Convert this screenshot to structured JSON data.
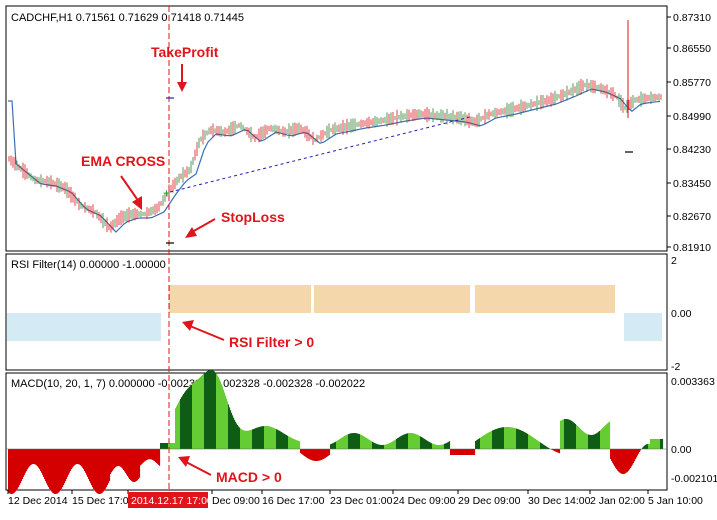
{
  "main_panel": {
    "header": "CADCHF,H1  0.71561 0.71629 0.71418 0.71445",
    "price_ticks": [
      "0.87310",
      "0.86550",
      "0.85770",
      "0.84990",
      "0.84230",
      "0.83450",
      "0.82670",
      "0.81910"
    ]
  },
  "rsi_panel": {
    "header": "RSI Filter(14) 0.00000 -1.00000",
    "ticks": [
      "2",
      "0.00",
      "-2"
    ]
  },
  "macd_panel": {
    "header": "MACD(10, 20, 1, 7) 0.000000 -0.002328 -0.002328 -0.002328 -0.002022",
    "ticks": [
      "0.003363",
      "0.00",
      "-0.002101"
    ]
  },
  "time_axis": {
    "labels": [
      "12 Dec 2014",
      "15 Dec 17:00",
      "2014.12.17 17:00",
      "Dec 09:00",
      "16 Dec 17:00",
      "23 Dec 01:00",
      "24 Dec 09:00",
      "29 Dec 09:00",
      "30 Dec 14:00",
      "2 Jan 02:00",
      "5 Jan 10:00"
    ],
    "highlight_label": "2014.12.17 17:00"
  },
  "annotations": {
    "take_profit": "TakeProfit",
    "ema_cross": "EMA CROSS",
    "stop_loss": "StopLoss",
    "rsi_filter": "RSI Filter > 0",
    "macd": "MACD > 0"
  },
  "colors": {
    "bull_candle": "#2e7d32",
    "bear_candle": "#e0141a",
    "ema": "#3d6fb6",
    "rsi_positive": "#e8b05a",
    "rsi_negative": "#a8d6ea",
    "macd_pos_light": "#66cc33",
    "macd_pos_dark": "#0f5c14",
    "macd_neg": "#d40000",
    "annotation": "#e0141a"
  }
}
